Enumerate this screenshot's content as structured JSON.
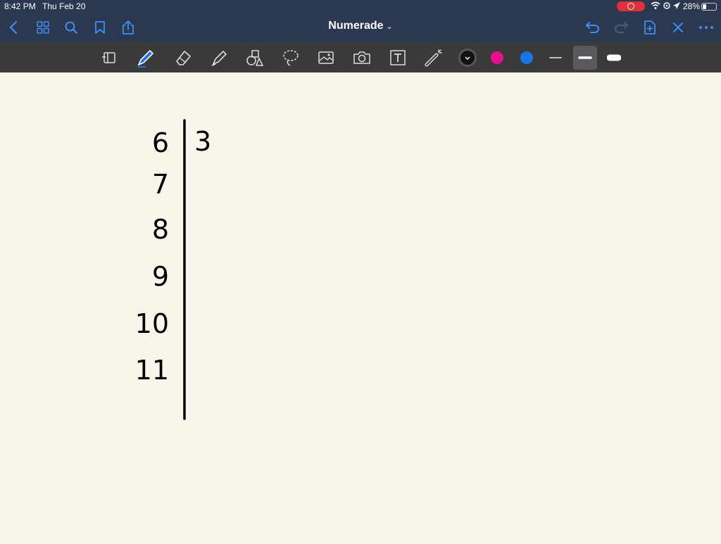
{
  "status": {
    "time": "8:42 PM",
    "date": "Thu Feb 20",
    "battery": "28%"
  },
  "nav": {
    "title": "Numerade",
    "title_chevron": "⌄"
  },
  "toolbar": {
    "tools": [
      "page-tool",
      "pen",
      "eraser",
      "highlighter",
      "shapes",
      "lasso",
      "image",
      "camera",
      "text",
      "laser"
    ],
    "selected_tool": "pen",
    "colors": [
      "#111111",
      "#e8108f",
      "#1a73e8"
    ],
    "selected_color": "#111111",
    "stroke_widths": [
      "thin",
      "medium",
      "thick"
    ],
    "selected_width": "medium"
  },
  "plot": {
    "stems": [
      "6",
      "7",
      "8",
      "9",
      "10",
      "11"
    ],
    "leaves": [
      "3",
      "",
      "",
      "",
      "",
      ""
    ]
  }
}
